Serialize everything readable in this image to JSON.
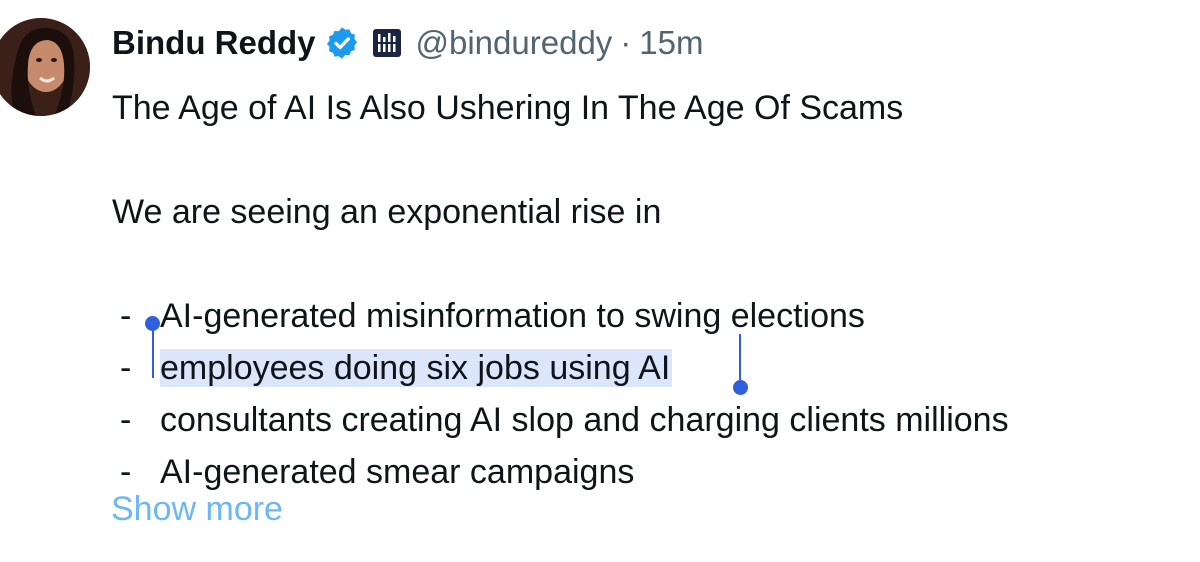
{
  "author": {
    "name": "Bindu Reddy",
    "handle": "@bindureddy",
    "separator": "·",
    "time": "15m"
  },
  "icons": {
    "verified": "verified-badge-icon",
    "affiliate": "affiliate-logo-icon"
  },
  "tweet": {
    "title_line": "The Age of AI Is Also Ushering In The Age Of Scams",
    "intro_line": "We are seeing an exponential rise in",
    "bullets": [
      {
        "dash": "-",
        "text": "AI-generated misinformation to swing elections"
      },
      {
        "dash": "-",
        "text": "employees doing six jobs using AI"
      },
      {
        "dash": "-",
        "text": "consultants creating AI slop and charging clients millions"
      },
      {
        "dash": "-",
        "text": "AI-generated smear campaigns"
      }
    ],
    "show_more": "Show more"
  },
  "colors": {
    "text": "#0f1419",
    "secondary": "#536471",
    "link": "#6cb8f5",
    "selection": "#dbe6fb",
    "selection_handle": "#2f5fdc",
    "verified": "#1d9bf0"
  }
}
